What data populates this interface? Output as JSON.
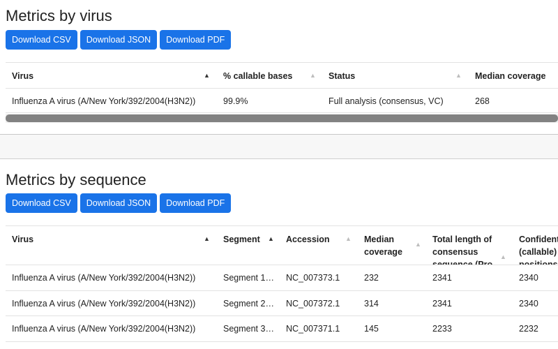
{
  "virus_section": {
    "title": "Metrics by virus",
    "buttons": [
      "Download CSV",
      "Download JSON",
      "Download PDF"
    ],
    "columns": [
      "Virus",
      "% callable bases",
      "Status",
      "Median coverage"
    ],
    "rows": [
      [
        "Influenza A virus (A/New York/392/2004(H3N2))",
        "99.9%",
        "Full analysis (consensus, VC)",
        "268"
      ]
    ]
  },
  "sequence_section": {
    "title": "Metrics by sequence",
    "buttons": [
      "Download CSV",
      "Download JSON",
      "Download PDF"
    ],
    "columns": [
      "Virus",
      "Segment",
      "Accession",
      "Median coverage",
      "Total length of consensus sequence (Pro",
      "Confident (callable) positions"
    ],
    "rows": [
      [
        "Influenza A virus (A/New York/392/2004(H3N2))",
        "Segment 1…",
        "NC_007373.1",
        "232",
        "2341",
        "2340"
      ],
      [
        "Influenza A virus (A/New York/392/2004(H3N2))",
        "Segment 2…",
        "NC_007372.1",
        "314",
        "2341",
        "2340"
      ],
      [
        "Influenza A virus (A/New York/392/2004(H3N2))",
        "Segment 3…",
        "NC_007371.1",
        "145",
        "2233",
        "2232"
      ]
    ]
  }
}
